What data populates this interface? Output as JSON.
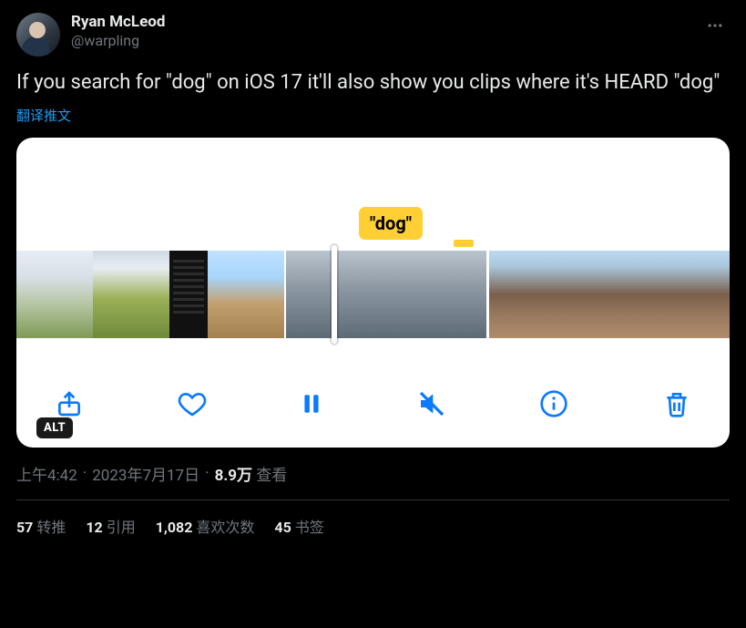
{
  "author": {
    "display_name": "Ryan McLeod",
    "handle": "@warpling"
  },
  "text": "If you search for \"dog\" on iOS 17 it'll also show you clips where it's HEARD \"dog\"",
  "translate_label": "翻译推文",
  "media": {
    "badge_text": "\"dog\"",
    "alt_label": "ALT",
    "icons": {
      "share": "share-icon",
      "heart": "heart-icon",
      "pause": "pause-icon",
      "mute": "mute-icon",
      "info": "info-icon",
      "trash": "trash-icon"
    }
  },
  "meta": {
    "time": "上午4:42",
    "date": "2023年7月17日",
    "views_value": "8.9万",
    "views_label": "查看"
  },
  "stats": {
    "retweets": {
      "count": "57",
      "label": "转推"
    },
    "quotes": {
      "count": "12",
      "label": "引用"
    },
    "likes": {
      "count": "1,082",
      "label": "喜欢次数"
    },
    "bookmarks": {
      "count": "45",
      "label": "书签"
    }
  }
}
